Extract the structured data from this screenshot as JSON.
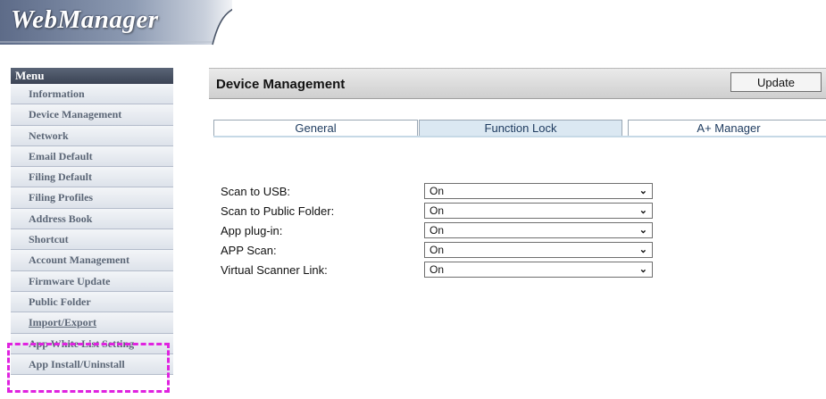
{
  "app": {
    "logo_text": "WebManager"
  },
  "sidebar": {
    "header": "Menu",
    "items": [
      {
        "label": "Information"
      },
      {
        "label": "Device Management"
      },
      {
        "label": "Network"
      },
      {
        "label": "Email Default"
      },
      {
        "label": "Filing Default"
      },
      {
        "label": "Filing Profiles"
      },
      {
        "label": "Address Book"
      },
      {
        "label": "Shortcut"
      },
      {
        "label": "Account Management"
      },
      {
        "label": "Firmware Update"
      },
      {
        "label": "Public Folder"
      },
      {
        "label": "Import/Export"
      },
      {
        "label": "App White List Setting"
      },
      {
        "label": "App Install/Uninstall"
      }
    ]
  },
  "main": {
    "title": "Device Management",
    "update_label": "Update",
    "tabs": [
      {
        "label": "General",
        "active": false
      },
      {
        "label": "Function Lock",
        "active": true
      },
      {
        "label": "A+ Manager",
        "active": false
      }
    ],
    "settings": [
      {
        "label": "Scan to USB:",
        "value": "On"
      },
      {
        "label": "Scan to Public Folder:",
        "value": "On"
      },
      {
        "label": "App plug-in:",
        "value": "On"
      },
      {
        "label": "APP Scan:",
        "value": "On"
      },
      {
        "label": "Virtual Scanner Link:",
        "value": "On"
      }
    ]
  },
  "colors": {
    "highlight": "#e022e0",
    "active_tab": "#dbe8f2",
    "menu_header": "#3b4354"
  }
}
